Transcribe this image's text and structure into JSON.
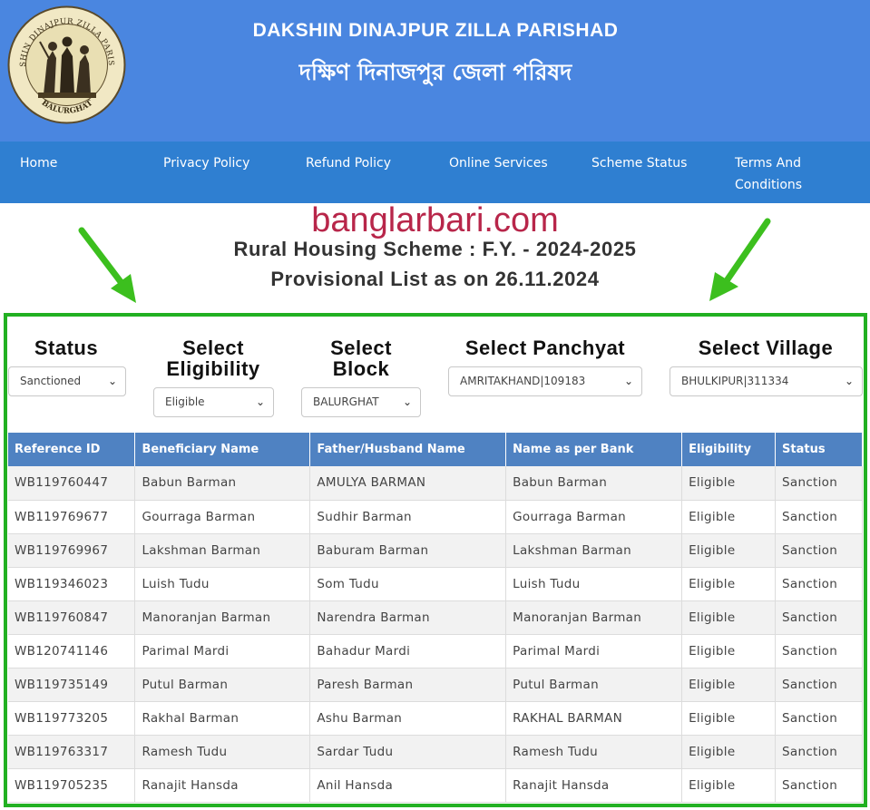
{
  "header": {
    "title_en": "DAKSHIN DINAJPUR ZILLA PARISHAD",
    "title_bn": "দক্ষিণ দিনাজপুর জেলা পরিষদ",
    "logo": {
      "top_text": "DAKSHIN DINAJPUR ZILLA PARISHAD",
      "bottom_text": "BALURGHAT"
    }
  },
  "nav": {
    "items": [
      {
        "label": "Home"
      },
      {
        "label": "Privacy Policy"
      },
      {
        "label": "Refund Policy"
      },
      {
        "label": "Online Services"
      },
      {
        "label": "Scheme Status"
      },
      {
        "label_line1": "Terms And",
        "label_line2": "Conditions"
      }
    ]
  },
  "watermark": "banglarbari.com",
  "scheme_title": "Rural Housing Scheme : F.Y. - 2024-2025",
  "list_title": "Provisional List as on 26.11.2024",
  "filters": {
    "status": {
      "label": "Status",
      "value": "Sanctioned"
    },
    "eligibility": {
      "label_line1": "Select",
      "label_line2": "Eligibility",
      "value": "Eligible"
    },
    "block": {
      "label_line1": "Select",
      "label_line2": "Block",
      "value": "BALURGHAT"
    },
    "panchyat": {
      "label": "Select Panchyat",
      "value": "AMRITAKHAND|109183"
    },
    "village": {
      "label": "Select Village",
      "value": "BHULKIPUR|311334"
    }
  },
  "table": {
    "headers": [
      "Reference ID",
      "Beneficiary Name",
      "Father/Husband Name",
      "Name as per Bank",
      "Eligibility",
      "Status"
    ],
    "rows": [
      [
        "WB119760447",
        "Babun Barman",
        "AMULYA BARMAN",
        "Babun Barman",
        "Eligible",
        "Sanction"
      ],
      [
        "WB119769677",
        "Gourraga Barman",
        "Sudhir Barman",
        "Gourraga Barman",
        "Eligible",
        "Sanction"
      ],
      [
        "WB119769967",
        "Lakshman Barman",
        "Baburam Barman",
        "Lakshman Barman",
        "Eligible",
        "Sanction"
      ],
      [
        "WB119346023",
        "Luish Tudu",
        "Som Tudu",
        "Luish Tudu",
        "Eligible",
        "Sanction"
      ],
      [
        "WB119760847",
        "Manoranjan Barman",
        "Narendra Barman",
        "Manoranjan Barman",
        "Eligible",
        "Sanction"
      ],
      [
        "WB120741146",
        "Parimal Mardi",
        "Bahadur Mardi",
        "Parimal Mardi",
        "Eligible",
        "Sanction"
      ],
      [
        "WB119735149",
        "Putul Barman",
        "Paresh Barman",
        "Putul Barman",
        "Eligible",
        "Sanction"
      ],
      [
        "WB119773205",
        "Rakhal Barman",
        "Ashu Barman",
        "RAKHAL BARMAN",
        "Eligible",
        "Sanction"
      ],
      [
        "WB119763317",
        "Ramesh Tudu",
        "Sardar Tudu",
        "Ramesh Tudu",
        "Eligible",
        "Sanction"
      ],
      [
        "WB119705235",
        "Ranajit Hansda",
        "Anil Hansda",
        "Ranajit Hansda",
        "Eligible",
        "Sanction"
      ]
    ]
  },
  "colors": {
    "header_bg": "#4a86e0",
    "nav_bg": "#2f7fd1",
    "table_header_bg": "#4f82c2",
    "highlight_frame": "#22b022",
    "arrow": "#3cbf1e",
    "watermark": "#b8264a"
  }
}
